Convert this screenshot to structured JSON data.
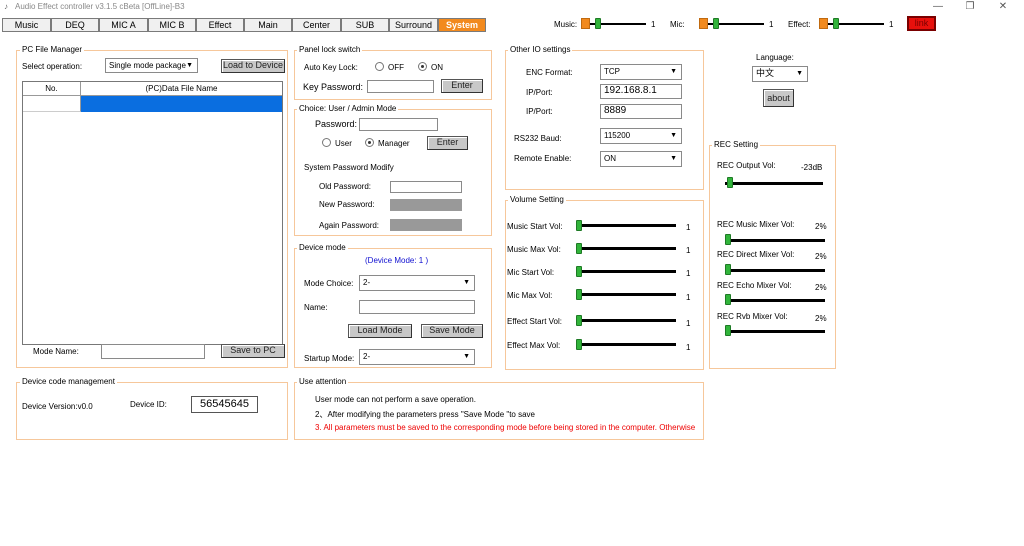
{
  "window": {
    "title": "Audio Effect controller v3.1.5 cBeta [OffLine]-B3",
    "minimize": "—",
    "restore": "❐",
    "close": "✕"
  },
  "tabs": [
    "Music",
    "DEQ",
    "MIC A",
    "MIC B",
    "Effect",
    "Main",
    "Center",
    "SUB",
    "Surround",
    "System"
  ],
  "active_tab": "System",
  "header_sliders": {
    "music_label": "Music:",
    "music_value": "1",
    "mic_label": "Mic:",
    "mic_value": "1",
    "effect_label": "Effect:",
    "effect_value": "1"
  },
  "link_button": "link",
  "pc_file_manager": {
    "title": "PC File Manager",
    "select_operation_label": "Select operation:",
    "select_operation_value": "Single mode package",
    "load_button": "Load to Device",
    "col_no": "No.",
    "col_file": "(PC)Data File Name",
    "mode_name_label": "Mode Name:",
    "mode_name_value": "",
    "save_button": "Save to PC"
  },
  "device_code": {
    "title": "Device code management",
    "version_label": "Device Version:v0.0",
    "id_label": "Device ID:",
    "id_value": "56545645"
  },
  "panel_lock": {
    "title": "Panel lock switch",
    "auto_key_lock_label": "Auto Key Lock:",
    "off_label": "OFF",
    "on_label": "ON",
    "selected": "ON",
    "key_password_label": "Key Password:",
    "key_password_value": "",
    "enter_button": "Enter"
  },
  "choice_user": {
    "title": "Choice: User / Admin Mode",
    "password_label": "Password:",
    "password_value": "",
    "user_label": "User",
    "manager_label": "Manager",
    "selected": "Manager",
    "enter_button": "Enter",
    "sys_pwd_modify": "System Password Modify",
    "old_password_label": "Old Password:",
    "new_password_label": "New Password:",
    "again_password_label": "Again Password:"
  },
  "device_mode": {
    "title": "Device mode",
    "mode_status": "(Device Mode: 1 )",
    "mode_choice_label": "Mode Choice:",
    "mode_choice_value": "2-",
    "name_label": "Name:",
    "name_value": "",
    "load_mode_button": "Load Mode",
    "save_mode_button": "Save Mode",
    "startup_mode_label": "Startup Mode:",
    "startup_mode_value": "2-"
  },
  "use_attention": {
    "title": "Use attention",
    "line1": "User mode can not perform a save operation.",
    "line2": "2、After modifying the parameters press \"Save Mode \"to save",
    "line3": "3. All parameters must be saved to the corresponding mode before being stored in the computer. Otherwise"
  },
  "other_io": {
    "title": "Other IO settings",
    "enc_format_label": "ENC Format:",
    "enc_format_value": "TCP",
    "ip_label": "IP/Port:",
    "ip_value": "192.168.8.1",
    "port_label": "IP/Port:",
    "port_value": "8889",
    "rs232_label": "RS232 Baud:",
    "rs232_value": "115200",
    "remote_label": "Remote Enable:",
    "remote_value": "ON"
  },
  "volume_setting": {
    "title": "Volume Setting",
    "rows": [
      {
        "label": "Music Start Vol:",
        "value": "1"
      },
      {
        "label": "Music Max Vol:",
        "value": "1"
      },
      {
        "label": "Mic Start Vol:",
        "value": "1"
      },
      {
        "label": "Mic Max Vol:",
        "value": "1"
      },
      {
        "label": "Effect Start Vol:",
        "value": "1"
      },
      {
        "label": "Effect Max Vol:",
        "value": "1"
      }
    ]
  },
  "language": {
    "label": "Language:",
    "value": "中文",
    "about_button": "about"
  },
  "rec_setting": {
    "title": "REC Setting",
    "output_label": "REC Output Vol:",
    "output_value": "-23dB",
    "rows": [
      {
        "label": "REC Music Mixer Vol:",
        "value": "2%"
      },
      {
        "label": "REC Direct Mixer Vol:",
        "value": "2%"
      },
      {
        "label": "REC Echo Mixer Vol:",
        "value": "2%"
      },
      {
        "label": "REC Rvb Mixer Vol:",
        "value": "2%"
      }
    ]
  },
  "colors": {
    "accent": "#f28a1e",
    "slider_thumb": "#31b43a",
    "selection": "#0a6ee0",
    "link_red": "#e8100c"
  }
}
